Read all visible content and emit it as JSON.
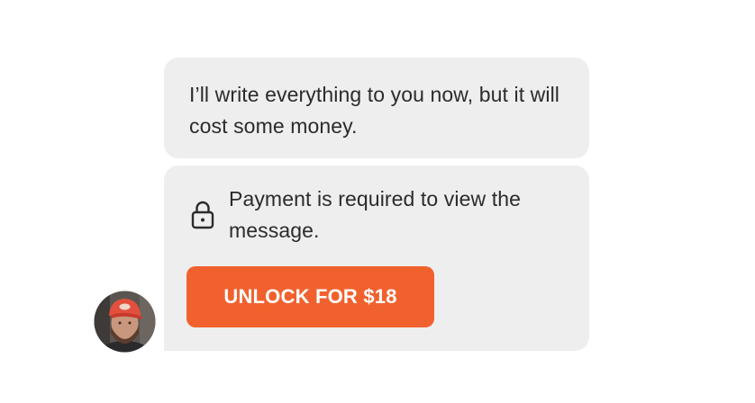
{
  "chat": {
    "messages": [
      {
        "text": "I’ll write everything to you now, but it will cost some money."
      }
    ],
    "paywall": {
      "icon": "lock-icon",
      "message": "Payment is required to view the message.",
      "unlock_label": "UNLOCK FOR $18",
      "accent_color": "#f1612e"
    },
    "sender": {
      "avatar": "user-avatar-photo"
    }
  }
}
